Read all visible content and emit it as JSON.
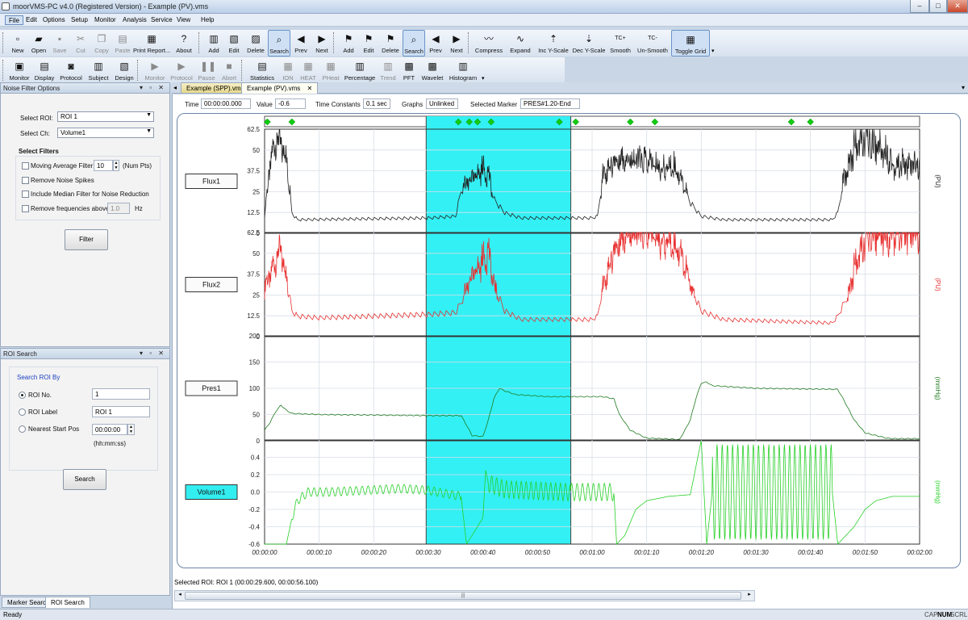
{
  "window": {
    "title": "moorVMS-PC v4.0 (Registered Version) - Example (PV).vms",
    "buttons": [
      "–",
      "□",
      "✕"
    ]
  },
  "menu": [
    "File",
    "Edit",
    "Options",
    "Setup",
    "Monitor",
    "Analysis",
    "Service",
    "View",
    "Help"
  ],
  "toolbar1": [
    {
      "label": "New",
      "icon": "new-file-icon",
      "glyph": "▫",
      "disabled": false
    },
    {
      "label": "Open",
      "icon": "open-folder-icon",
      "glyph": "▰",
      "disabled": false
    },
    {
      "label": "Save",
      "icon": "save-icon",
      "glyph": "▪",
      "disabled": true
    },
    {
      "label": "Cut",
      "icon": "cut-icon",
      "glyph": "✂",
      "disabled": true
    },
    {
      "label": "Copy",
      "icon": "copy-icon",
      "glyph": "❐",
      "disabled": true
    },
    {
      "label": "Paste",
      "icon": "paste-icon",
      "glyph": "▤",
      "disabled": true
    },
    {
      "label": "Print Report...",
      "icon": "print-icon",
      "glyph": "▦",
      "disabled": false
    },
    {
      "label": "About",
      "icon": "about-icon",
      "glyph": "?",
      "disabled": false
    },
    {
      "label": "Add",
      "icon": "add-icon",
      "glyph": "▥",
      "disabled": false
    },
    {
      "label": "Edit",
      "icon": "edit-icon",
      "glyph": "▧",
      "disabled": false
    },
    {
      "label": "Delete",
      "icon": "delete-icon",
      "glyph": "▨",
      "disabled": false
    },
    {
      "label": "Search",
      "icon": "search-icon",
      "glyph": "⌕",
      "disabled": false,
      "pressed": true
    },
    {
      "label": "Prev",
      "icon": "prev-arrow-icon",
      "glyph": "◀",
      "disabled": false
    },
    {
      "label": "Next",
      "icon": "next-arrow-icon",
      "glyph": "▶",
      "disabled": false
    },
    {
      "label": "Add",
      "icon": "marker-add-icon",
      "glyph": "⚑",
      "disabled": false
    },
    {
      "label": "Edit",
      "icon": "marker-edit-icon",
      "glyph": "⚑",
      "disabled": false
    },
    {
      "label": "Delete",
      "icon": "marker-delete-icon",
      "glyph": "⚑",
      "disabled": false
    },
    {
      "label": "Search",
      "icon": "marker-search-icon",
      "glyph": "⌕",
      "disabled": false,
      "pressed": true
    },
    {
      "label": "Prev",
      "icon": "marker-prev-icon",
      "glyph": "◀",
      "disabled": false
    },
    {
      "label": "Next",
      "icon": "marker-next-icon",
      "glyph": "▶",
      "disabled": false
    },
    {
      "label": "Compress",
      "icon": "compress-icon",
      "glyph": "〰",
      "disabled": false
    },
    {
      "label": "Expand",
      "icon": "expand-icon",
      "glyph": "∿",
      "disabled": false
    },
    {
      "label": "Inc Y-Scale",
      "icon": "inc-y-scale-icon",
      "glyph": "⇡",
      "disabled": false
    },
    {
      "label": "Dec Y-Scale",
      "icon": "dec-y-scale-icon",
      "glyph": "⇣",
      "disabled": false
    },
    {
      "label": "Smooth",
      "icon": "smooth-icon",
      "glyph": "TC+",
      "disabled": false
    },
    {
      "label": "Un-Smooth",
      "icon": "unsmooth-icon",
      "glyph": "TC-",
      "disabled": false
    },
    {
      "label": "Toggle Grid",
      "icon": "grid-icon",
      "glyph": "▦",
      "disabled": false,
      "pressed": true
    }
  ],
  "toolbar2": [
    {
      "label": "Monitor",
      "icon": "monitor-icon",
      "glyph": "▣",
      "disabled": false
    },
    {
      "label": "Display",
      "icon": "display-icon",
      "glyph": "▤",
      "disabled": false
    },
    {
      "label": "Protocol",
      "icon": "protocol-icon",
      "glyph": "◙",
      "disabled": false
    },
    {
      "label": "Subject",
      "icon": "subject-icon",
      "glyph": "▥",
      "disabled": false
    },
    {
      "label": "Design",
      "icon": "design-icon",
      "glyph": "▧",
      "disabled": false
    },
    {
      "label": "Monitor",
      "icon": "play-icon",
      "glyph": "▶",
      "disabled": true
    },
    {
      "label": "Protocol",
      "icon": "step-icon",
      "glyph": "▶",
      "disabled": true
    },
    {
      "label": "Pause",
      "icon": "pause-icon",
      "glyph": "❚❚",
      "disabled": true
    },
    {
      "label": "Abort",
      "icon": "stop-icon",
      "glyph": "■",
      "disabled": true
    },
    {
      "label": "Statistics",
      "icon": "statistics-icon",
      "glyph": "▤",
      "disabled": false
    },
    {
      "label": "ION",
      "icon": "ion-icon",
      "glyph": "▦",
      "disabled": true
    },
    {
      "label": "HEAT",
      "icon": "heat-icon",
      "glyph": "▦",
      "disabled": true
    },
    {
      "label": "PHeat",
      "icon": "pheat-icon",
      "glyph": "▦",
      "disabled": true
    },
    {
      "label": "Percentage",
      "icon": "percentage-icon",
      "glyph": "▥",
      "disabled": false
    },
    {
      "label": "Trend",
      "icon": "trend-icon",
      "glyph": "▥",
      "disabled": true
    },
    {
      "label": "PFT",
      "icon": "pft-icon",
      "glyph": "▩",
      "disabled": false
    },
    {
      "label": "Wavelet",
      "icon": "wavelet-icon",
      "glyph": "▩",
      "disabled": false
    },
    {
      "label": "Histogram",
      "icon": "histogram-icon",
      "glyph": "▥",
      "disabled": false
    }
  ],
  "noise_filter": {
    "title": "Noise Filter Options",
    "select_roi_label": "Select ROI:",
    "select_roi_value": "ROI 1",
    "select_ch_label": "Select Ch:",
    "select_ch_value": "Volume1",
    "filters_heading": "Select Filters",
    "moving_average_label": "Moving Average Filter",
    "moving_average_value": "10",
    "num_pts_label": "(Num Pts)",
    "remove_spikes_label": "Remove Noise Spikes",
    "median_label": "Include Median Filter for Noise Reduction",
    "remove_freq_label": "Remove frequencies above",
    "remove_freq_value": "1.0",
    "hz_label": "Hz",
    "filter_button": "Filter"
  },
  "roi_search": {
    "title": "ROI Search",
    "heading": "Search ROI By",
    "roi_no_label": "ROI No.",
    "roi_no_value": "1",
    "roi_label_label": "ROI Label",
    "roi_label_value": "ROI 1",
    "start_pos_label": "Nearest Start Pos",
    "start_pos_value": "00:00:00",
    "start_pos_hint": "(hh:mm:ss)",
    "search_button": "Search"
  },
  "bottom_tabs": [
    "Marker Search",
    "ROI Search"
  ],
  "doc_tabs": [
    "Example (SPP).vms",
    "Example (PV).vms"
  ],
  "infobar": {
    "time_label": "Time",
    "time_value": "00:00:00.000",
    "value_label": "Value",
    "value_value": "-0.6",
    "tc_label": "Time Constants",
    "tc_value": "0.1 sec",
    "graphs_label": "Graphs",
    "graphs_value": "Unlinked",
    "marker_label": "Selected Marker",
    "marker_value": "PRES#1.20-End"
  },
  "selected_roi": "Selected ROI: ROI 1 (00:00:29.600, 00:00:56.100)",
  "status": {
    "left": "Ready",
    "right": [
      "CAP",
      "NUM",
      "SCRL"
    ]
  },
  "chart_data": {
    "type": "line",
    "x_unit": "hh:mm:ss",
    "xlim": [
      0,
      120
    ],
    "x_ticks": [
      0,
      10,
      20,
      30,
      40,
      50,
      60,
      70,
      80,
      90,
      100,
      110,
      120
    ],
    "x_tick_labels": [
      "00:00:00",
      "00:00:10",
      "00:00:20",
      "00:00:30",
      "00:00:40",
      "00:00:50",
      "00:01:00",
      "00:01:10",
      "00:01:20",
      "00:01:30",
      "00:01:40",
      "00:01:50",
      "00:02:00"
    ],
    "grid": true,
    "roi": {
      "start": 29.6,
      "end": 56.1,
      "color": "#33f0f4"
    },
    "markers": [
      0.5,
      5,
      35.5,
      37.5,
      39,
      41.5,
      54,
      57,
      67,
      71.5,
      96.5,
      100
    ],
    "marker_color": "#11cc11",
    "channels": [
      {
        "name": "Flux1",
        "unit": "(PU)",
        "color": "#222222",
        "ylim": [
          0,
          62.5
        ],
        "ticks": [
          0,
          12.5,
          25,
          37.5,
          50,
          62.5
        ],
        "selected": false,
        "mode": "pulse",
        "amp": 2.5,
        "period": 1.1,
        "points": [
          [
            0,
            10
          ],
          [
            1,
            40
          ],
          [
            2,
            55
          ],
          [
            3,
            52
          ],
          [
            4,
            45
          ],
          [
            5,
            12
          ],
          [
            6,
            8
          ],
          [
            30,
            9
          ],
          [
            35,
            10
          ],
          [
            36,
            25
          ],
          [
            38,
            32
          ],
          [
            40,
            38
          ],
          [
            41,
            35
          ],
          [
            42,
            20
          ],
          [
            44,
            12
          ],
          [
            47,
            9
          ],
          [
            60,
            9
          ],
          [
            61,
            10
          ],
          [
            62,
            35
          ],
          [
            64,
            42
          ],
          [
            66,
            45
          ],
          [
            70,
            42
          ],
          [
            73,
            38
          ],
          [
            75,
            40
          ],
          [
            76,
            35
          ],
          [
            78,
            18
          ],
          [
            80,
            10
          ],
          [
            84,
            8
          ],
          [
            104,
            8
          ],
          [
            105,
            12
          ],
          [
            106,
            30
          ],
          [
            108,
            50
          ],
          [
            110,
            55
          ],
          [
            112,
            52
          ],
          [
            114,
            48
          ],
          [
            115,
            40
          ]
        ]
      },
      {
        "name": "Flux2",
        "unit": "(PU)",
        "color": "#e83030",
        "ylim": [
          0,
          62.5
        ],
        "ticks": [
          0,
          12.5,
          25,
          37.5,
          50,
          62.5
        ],
        "selected": false,
        "mode": "pulse",
        "amp": 3,
        "period": 1.1,
        "points": [
          [
            0,
            30
          ],
          [
            1,
            35
          ],
          [
            2,
            45
          ],
          [
            3,
            50
          ],
          [
            4,
            35
          ],
          [
            5,
            15
          ],
          [
            6,
            12
          ],
          [
            10,
            11
          ],
          [
            20,
            12
          ],
          [
            30,
            13
          ],
          [
            35,
            14
          ],
          [
            36,
            20
          ],
          [
            38,
            35
          ],
          [
            40,
            45
          ],
          [
            41,
            50
          ],
          [
            42,
            30
          ],
          [
            44,
            15
          ],
          [
            47,
            10
          ],
          [
            60,
            10
          ],
          [
            61,
            12
          ],
          [
            62,
            30
          ],
          [
            64,
            50
          ],
          [
            66,
            62
          ],
          [
            70,
            62
          ],
          [
            72,
            58
          ],
          [
            75,
            55
          ],
          [
            76,
            52
          ],
          [
            78,
            30
          ],
          [
            80,
            15
          ],
          [
            84,
            10
          ],
          [
            104,
            8
          ],
          [
            105,
            12
          ],
          [
            107,
            25
          ],
          [
            108,
            40
          ],
          [
            110,
            55
          ],
          [
            111,
            62
          ]
        ]
      },
      {
        "name": "Pres1",
        "unit": "(mmHg)",
        "color": "#207a20",
        "ylim": [
          0,
          200
        ],
        "ticks": [
          0,
          50,
          100,
          150,
          200
        ],
        "selected": false,
        "mode": "smooth",
        "amp": 0.8,
        "period": 1.2,
        "points": [
          [
            0,
            20
          ],
          [
            1,
            35
          ],
          [
            2,
            55
          ],
          [
            3,
            68
          ],
          [
            4,
            58
          ],
          [
            5,
            52
          ],
          [
            10,
            50
          ],
          [
            30,
            48
          ],
          [
            36,
            48
          ],
          [
            37,
            30
          ],
          [
            38,
            10
          ],
          [
            40,
            8
          ],
          [
            41,
            40
          ],
          [
            42,
            80
          ],
          [
            43,
            100
          ],
          [
            44,
            95
          ],
          [
            46,
            88
          ],
          [
            52,
            84
          ],
          [
            62,
            84
          ],
          [
            64,
            80
          ],
          [
            65,
            50
          ],
          [
            67,
            20
          ],
          [
            70,
            5
          ],
          [
            75,
            3
          ],
          [
            76,
            2
          ],
          [
            77,
            20
          ],
          [
            78,
            40
          ],
          [
            79,
            80
          ],
          [
            80,
            110
          ],
          [
            81,
            112
          ],
          [
            82,
            105
          ],
          [
            90,
            100
          ],
          [
            105,
            98
          ],
          [
            106,
            80
          ],
          [
            108,
            40
          ],
          [
            110,
            15
          ],
          [
            114,
            5
          ],
          [
            115,
            4
          ]
        ]
      },
      {
        "name": "Volume1",
        "unit": "(mmHg)",
        "color": "#28d028",
        "ylim": [
          -0.6,
          0.6
        ],
        "ticks": [
          -0.6,
          -0.4,
          -0.2,
          0.0,
          0.2,
          0.4
        ],
        "selected": true,
        "mode": "volume",
        "points": [
          [
            0,
            -0.6
          ],
          [
            4,
            -0.6
          ],
          [
            5,
            -0.3
          ],
          [
            6,
            -0.1
          ],
          [
            8,
            0.0
          ],
          [
            12,
            0.0
          ],
          [
            25,
            0.04
          ],
          [
            30,
            0.02
          ],
          [
            36,
            -0.05
          ],
          [
            37,
            -0.6
          ],
          [
            38,
            -0.5
          ],
          [
            40,
            -0.3
          ],
          [
            40.5,
            0.25
          ],
          [
            41,
            0.1
          ],
          [
            44,
            0.03
          ],
          [
            55,
            0.0
          ],
          [
            64,
            0.0
          ],
          [
            64.5,
            -0.6
          ],
          [
            66,
            -0.5
          ],
          [
            68,
            -0.2
          ],
          [
            70,
            -0.1
          ],
          [
            74,
            -0.05
          ],
          [
            78,
            -0.03
          ],
          [
            80,
            0.6
          ],
          [
            81,
            -0.6
          ],
          [
            82,
            0.0
          ],
          [
            104,
            0.0
          ],
          [
            105,
            -0.6
          ],
          [
            108,
            -0.4
          ],
          [
            110,
            -0.2
          ],
          [
            112,
            -0.1
          ],
          [
            115,
            -0.05
          ]
        ]
      }
    ]
  }
}
